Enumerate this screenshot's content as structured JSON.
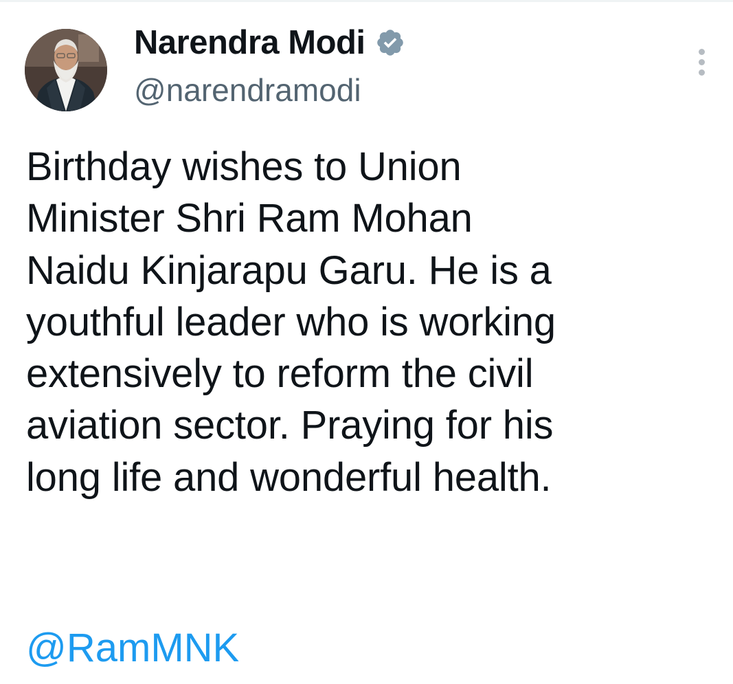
{
  "author": {
    "display_name": "Narendra Modi",
    "handle": "@narendramodi",
    "verified_icon": "verified-badge-icon",
    "verified_color": "#829aab"
  },
  "menu": {
    "icon": "more-options-icon"
  },
  "tweet": {
    "text": "Birthday wishes to Union\nMinister Shri Ram Mohan\nNaidu Kinjarapu Garu. He is a\nyouthful leader who is working\nextensively to reform the civil\naviation sector. Praying for his\nlong life and wonderful health.",
    "mention": "@RamMNK"
  },
  "colors": {
    "text": "#0f1419",
    "secondary": "#536471",
    "link": "#1d9bf0"
  }
}
